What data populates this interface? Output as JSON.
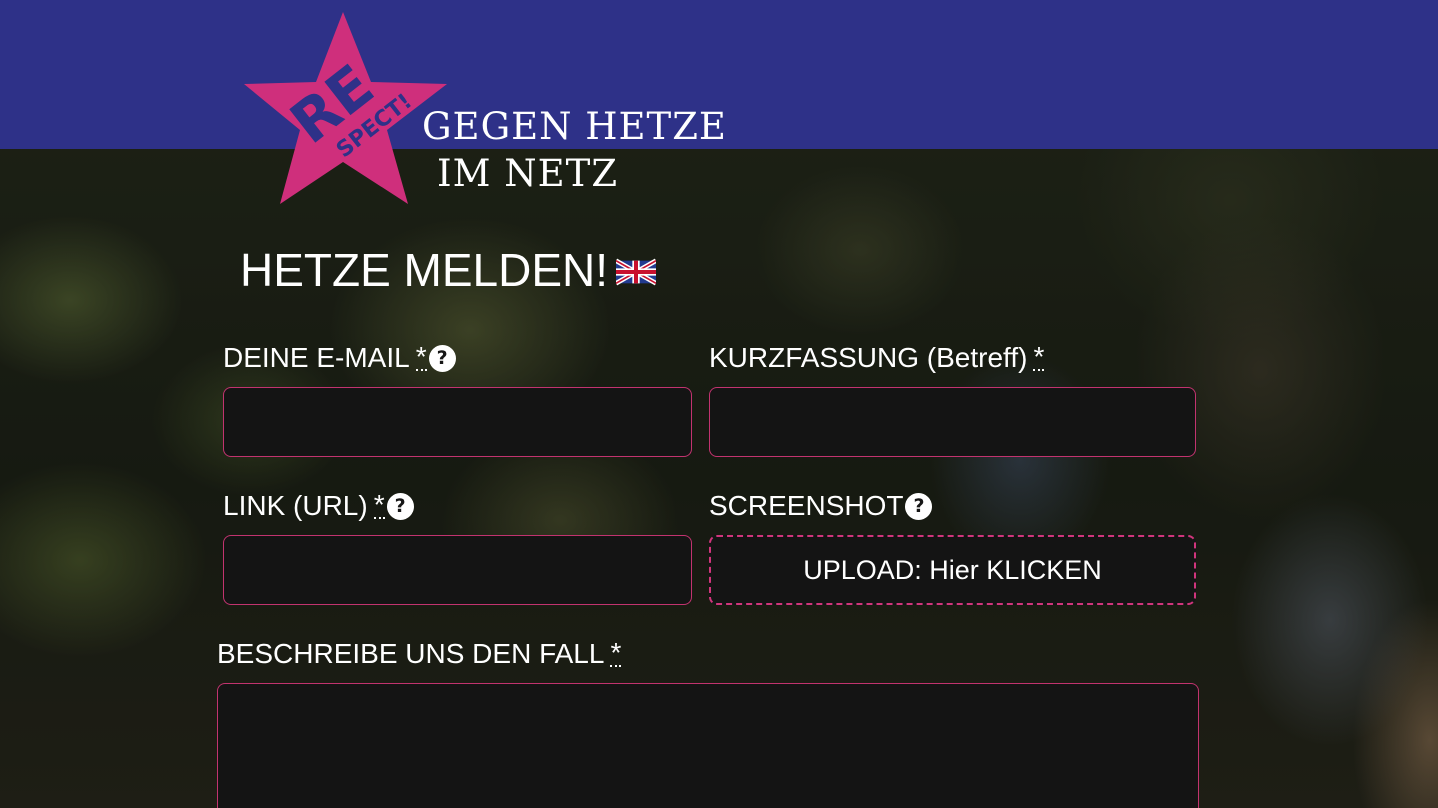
{
  "logo": {
    "star_text_big": "RE",
    "star_text_small": "SPECT!",
    "line1": "GEGEN HETZE",
    "line2": "IM NETZ"
  },
  "page_title": "HETZE MELDEN!",
  "language_switch": "english-flag-icon",
  "form": {
    "email": {
      "label": "DEINE E-MAIL",
      "required_mark": "*",
      "help_icon": "question-circle-icon",
      "value": ""
    },
    "subject": {
      "label": "KURZFASSUNG (Betreff)",
      "required_mark": "*",
      "value": ""
    },
    "link": {
      "label": "LINK (URL)",
      "required_mark": "*",
      "help_icon": "question-circle-icon",
      "value": ""
    },
    "screenshot": {
      "label": "SCREENSHOT",
      "help_icon": "question-circle-icon",
      "upload_label": "UPLOAD: Hier KLICKEN"
    },
    "description": {
      "label": "BESCHREIBE UNS DEN FALL",
      "required_mark": "*",
      "value": ""
    }
  },
  "colors": {
    "header": "#2e3188",
    "accent": "#d0357c",
    "field_bg": "#141414"
  }
}
